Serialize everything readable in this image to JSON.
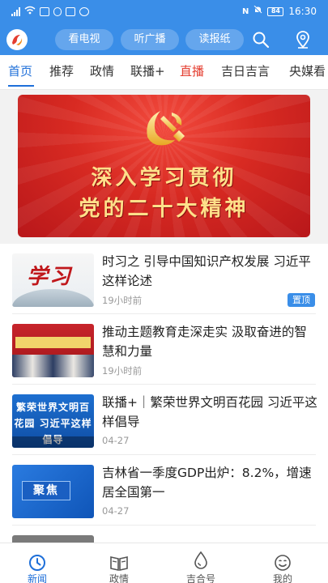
{
  "status_bar": {
    "time": "16:30",
    "battery": "84"
  },
  "header": {
    "buttons": [
      "看电视",
      "听广播",
      "读报纸"
    ],
    "accent_color": "#3a8ee8"
  },
  "tabs": [
    {
      "label": "首页",
      "state": "active"
    },
    {
      "label": "推荐"
    },
    {
      "label": "政情"
    },
    {
      "label": "联播+"
    },
    {
      "label": "直播",
      "state": "highlight"
    },
    {
      "label": "吉日吉言"
    },
    {
      "label": "央媒看"
    }
  ],
  "banner": {
    "line1": "深入学习贯彻",
    "line2": "党的二十大精神"
  },
  "news": [
    {
      "title": "时习之 引导中国知识产权发展 习近平这样论述",
      "meta": "19小时前",
      "badge": "置顶",
      "thumb_text": "学习"
    },
    {
      "title": "推动主题教育走深走实 汲取奋进的智慧和力量",
      "meta": "19小时前"
    },
    {
      "title": "联播+｜繁荣世界文明百花园 习近平这样倡导",
      "meta": "04-27",
      "thumb_text": "繁荣世界文明百花园 习近平这样倡导"
    },
    {
      "title": "吉林省一季度GDP出炉：8.2%，增速居全国第一",
      "meta": "04-27",
      "thumb_text": "聚焦"
    }
  ],
  "bottom_nav": [
    {
      "label": "新闻",
      "icon": "clock-icon",
      "state": "active"
    },
    {
      "label": "政情",
      "icon": "book-icon"
    },
    {
      "label": "吉合号",
      "icon": "drop-icon"
    },
    {
      "label": "我的",
      "icon": "smile-icon"
    }
  ]
}
